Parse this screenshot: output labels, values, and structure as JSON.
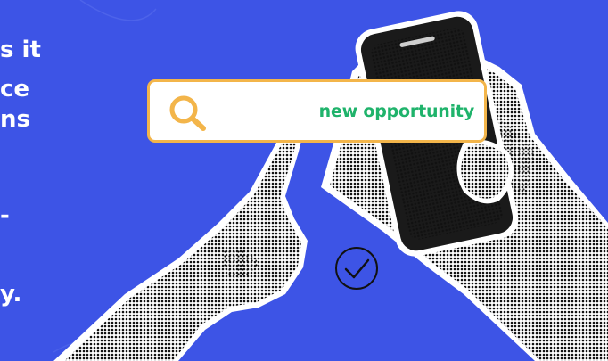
{
  "left_text": {
    "line1": "s it",
    "line2": "ce",
    "line3": "ns",
    "line4": "-",
    "line5": "y."
  },
  "search": {
    "query": "new opportunity"
  },
  "colors": {
    "background": "#3d54e6",
    "search_border": "#f3b54a",
    "search_text": "#1fb36b",
    "text": "#ffffff"
  },
  "icons": {
    "search": "magnifier-icon",
    "check": "check-circle-icon"
  }
}
